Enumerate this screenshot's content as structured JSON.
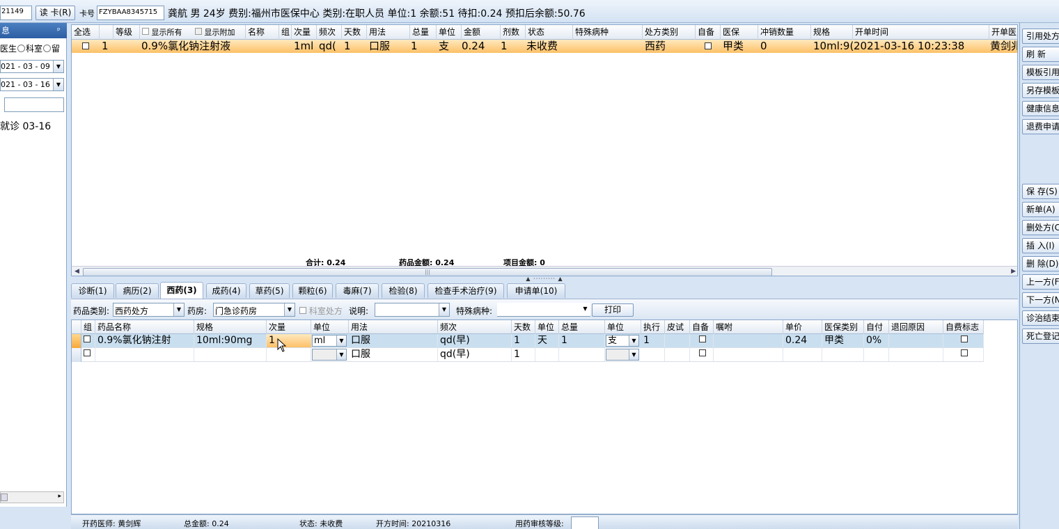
{
  "header": {
    "patient_id": "21149",
    "read_card_btn": "读 卡(R)",
    "card_label": "卡号",
    "card_no": "FZYBAA8345715",
    "patient_info": "龚航  男  24岁  费别:福州市医保中心  类别:在职人员  单位:1  余额:51  待扣:0.24  预扣后余额:50.76"
  },
  "left_panel": {
    "title": "息",
    "pin": "ᵖ",
    "radio_doctor": "医生",
    "radio_dept": "科室",
    "radio_stay": "留",
    "date_from": "021 - 03 - 09",
    "date_to": "021 - 03 - 16",
    "visit_item": "就诊 03-16"
  },
  "main_grid": {
    "headers": [
      "全选",
      "",
      "等级",
      "显示所有",
      "显示附加",
      "名称",
      "组",
      "次量",
      "频次",
      "天数",
      "用法",
      "总量",
      "单位",
      "金额",
      "剂数",
      "状态",
      "特殊病种",
      "处方类别",
      "自备",
      "医保",
      "冲销数量",
      "规格",
      "开单时间",
      "开单医"
    ],
    "row": {
      "no": "1",
      "name": "0.9%氯化钠注射液",
      "dose": "1ml",
      "freq": "qd(",
      "days": "1",
      "usage": "口服",
      "total": "1",
      "unit": "支",
      "amount": "0.24",
      "doses": "1",
      "status": "未收费",
      "rx_type": "西药",
      "insurance": "甲类",
      "offset_qty": "0",
      "spec": "10ml:9(",
      "open_time": "2021-03-16 10:23:38",
      "doctor": "黄剑兆"
    },
    "totals": {
      "sum": "合计:  0.24",
      "drug_amount": "药品金额:  0.24",
      "item_amount": "项目金额:  0"
    }
  },
  "tabs": [
    {
      "label": "诊断(1)"
    },
    {
      "label": "病历(2)"
    },
    {
      "label": "西药(3)"
    },
    {
      "label": "成药(4)"
    },
    {
      "label": "草药(5)"
    },
    {
      "label": "颗粒(6)"
    },
    {
      "label": "毒麻(7)"
    },
    {
      "label": "检验(8)"
    },
    {
      "label": "检查手术治疗(9)"
    },
    {
      "label": "申请单(10)"
    }
  ],
  "filter": {
    "drug_type_label": "药品类别:",
    "drug_type_value": "西药处方",
    "pharmacy_label": "药房:",
    "pharmacy_value": "门急诊药房",
    "dept_rx_label": "科室处方",
    "note_label": "说明:",
    "note_value": "",
    "special_label": "特殊病种:",
    "special_value": "",
    "print_btn": "打印"
  },
  "detail_grid": {
    "headers": [
      "组",
      "药品名称",
      "规格",
      "次量",
      "单位",
      "用法",
      "频次",
      "天数",
      "单位",
      "总量",
      "单位",
      "执行",
      "皮试",
      "自备",
      "嘱咐",
      "单价",
      "医保类别",
      "自付",
      "退回原因",
      "自费标志"
    ],
    "rows": [
      {
        "name": "0.9%氯化钠注射",
        "spec": "10ml:90mg",
        "dose": "1",
        "dose_unit": "ml",
        "usage": "口服",
        "freq": "qd(早)",
        "days": "1",
        "day_unit": "天",
        "total": "1",
        "total_unit": "支",
        "exec": "1",
        "price": "0.24",
        "ins_type": "甲类",
        "self_pay": "0%"
      },
      {
        "name": "",
        "spec": "",
        "dose": "",
        "dose_unit": "",
        "usage": "口服",
        "freq": "qd(早)",
        "days": "1",
        "day_unit": "",
        "total": "",
        "total_unit": "",
        "exec": "",
        "price": "",
        "ins_type": "",
        "self_pay": ""
      }
    ]
  },
  "status_bar": {
    "doctor": "开药医师: 黄剑辉",
    "total": "总金额: 0.24",
    "status": "状态: 未收费",
    "rx_time": "开方时间: 20210316",
    "audit_label": "用药审核等级:"
  },
  "right_buttons": [
    {
      "label": "引用处方"
    },
    {
      "label": "刷 新"
    },
    {
      "label": "模板引用"
    },
    {
      "label": "另存模板"
    },
    {
      "label": "健康信息"
    },
    {
      "label": "退费申请"
    },
    {
      "label": "保 存(S)"
    },
    {
      "label": "新单(A)"
    },
    {
      "label": "删处方(C)"
    },
    {
      "label": "插 入(I)"
    },
    {
      "label": "删 除(D)"
    },
    {
      "label": "上一方(F)"
    },
    {
      "label": "下一方(N)"
    },
    {
      "label": "诊治结束"
    },
    {
      "label": "死亡登记"
    }
  ],
  "colors": {
    "accent_blue": "#2c5ea3",
    "row_highlight": "#fcc067",
    "selected_row": "#c9dff0"
  }
}
